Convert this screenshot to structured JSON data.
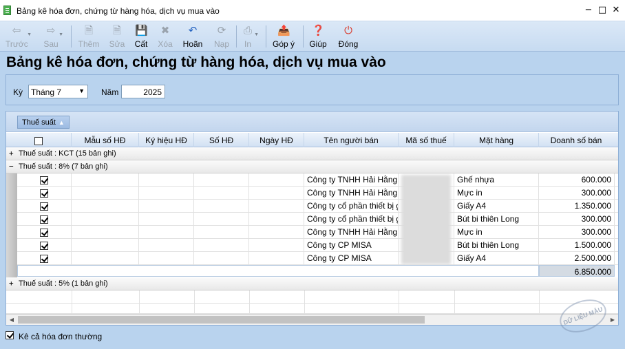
{
  "window": {
    "title": "Bảng kê hóa đơn, chứng từ hàng hóa, dịch vụ mua vào",
    "minimize": "−",
    "maximize": "□",
    "close": "✕"
  },
  "toolbar": {
    "back": "Trước",
    "forward": "Sau",
    "add": "Thêm",
    "edit": "Sửa",
    "save": "Cất",
    "delete": "Xóa",
    "undo": "Hoãn",
    "reload": "Nạp",
    "print": "In",
    "feedback": "Góp ý",
    "help": "Giúp",
    "close": "Đóng"
  },
  "heading": "Bảng kê hóa đơn, chứng từ hàng hóa, dịch vụ mua vào",
  "filter": {
    "period_label": "Kỳ",
    "period_value": "Tháng 7",
    "year_label": "Năm",
    "year_value": "2025"
  },
  "grid": {
    "group_chip": "Thuế suất",
    "columns": [
      "Mẫu số HĐ",
      "Ký hiệu HĐ",
      "Số HĐ",
      "Ngày HĐ",
      "Tên người bán",
      "Mã số thuế",
      "Mặt hàng",
      "Doanh số bán"
    ],
    "groups": [
      {
        "expander": "+",
        "label": "Thuế suất : KCT (15 bản ghi)"
      },
      {
        "expander": "−",
        "label": "Thuế suất : 8% (7 bản ghi)"
      },
      {
        "expander": "+",
        "label": "Thuế suất : 5% (1 bản ghi)"
      }
    ],
    "rows": [
      {
        "checked": true,
        "seller": "Công ty TNHH Hải Hằng",
        "item": "Ghế nhựa",
        "amount": "600.000"
      },
      {
        "checked": true,
        "seller": "Công ty TNHH Hải Hằng",
        "item": "Mực in",
        "amount": "300.000"
      },
      {
        "checked": true,
        "seller": "Công ty cổ phần thiết bị g",
        "item": "Giấy A4",
        "amount": "1.350.000"
      },
      {
        "checked": true,
        "seller": "Công ty cổ phần thiết bị g",
        "item": "Bút bi thiên Long",
        "amount": "300.000"
      },
      {
        "checked": true,
        "seller": "Công ty TNHH Hải Hằng",
        "item": "Mực in",
        "amount": "300.000"
      },
      {
        "checked": true,
        "seller": "Công ty CP MISA",
        "item": "Bút bi thiên Long",
        "amount": "1.500.000"
      },
      {
        "checked": true,
        "seller": "Công ty CP MISA",
        "item": "Giấy A4",
        "amount": "2.500.000"
      }
    ],
    "group_total": "6.850.000"
  },
  "footer": {
    "include_normal_invoices": "Kê cả hóa đơn thường"
  },
  "watermark": "DỮ LIỆU MẪU",
  "colors": {
    "window_bg": "#b9d3ee",
    "toolbar_bg": "#d3e3f5",
    "grid_bg": "#ffffff",
    "group_row_bg": "#ececec"
  }
}
